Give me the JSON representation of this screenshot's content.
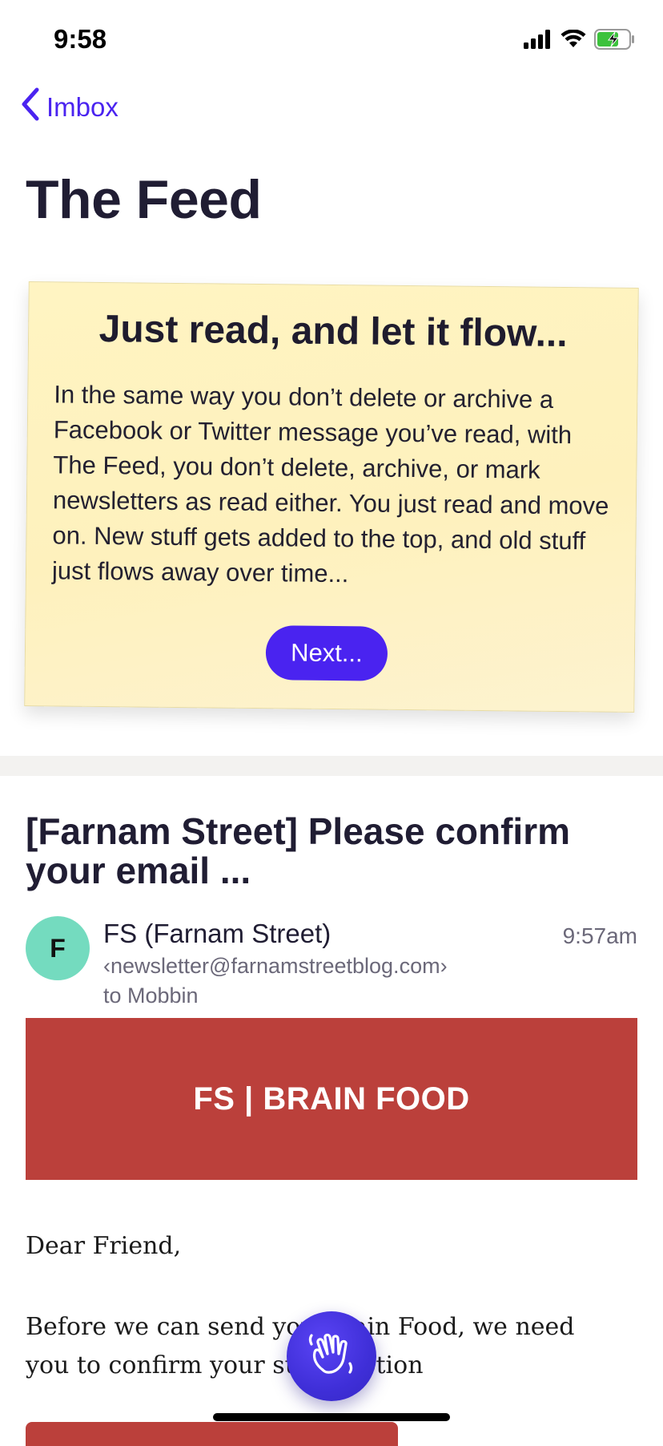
{
  "status_bar": {
    "time": "9:58",
    "icons": [
      "signal-icon",
      "wifi-icon",
      "battery-charging-icon"
    ],
    "battery_color": "#3cc23c"
  },
  "nav": {
    "back_label": "Imbox",
    "back_icon": "chevron-left-icon",
    "accent_color": "#4a23f0"
  },
  "page": {
    "title": "The Feed"
  },
  "tip_card": {
    "heading": "Just read, and let it flow...",
    "body": "In the same way you don’t delete or archive a Facebook or Twitter message you’ve read, with The Feed, you don’t delete, archive, or mark newsletters as read either. You just read and move on. New stuff gets added to the top, and old stuff just flows away over time...",
    "button_label": "Next...",
    "background_color": "#fef1bd"
  },
  "email": {
    "subject": "[Farnam Street] Please confirm your email ...",
    "sender": {
      "avatar_letter": "F",
      "avatar_color": "#74dbbf",
      "name": "FS (Farnam Street)",
      "address": "‹newsletter@farnamstreetblog.com›",
      "to": "to Mobbin",
      "time": "9:57am"
    },
    "banner": {
      "text": "FS | BRAIN FOOD",
      "background_color": "#bb403b"
    },
    "greeting": "Dear Friend,",
    "paragraph": "Before we can send you Brain Food, we need you to confirm your subscription"
  },
  "fab": {
    "icon": "waving-hand-icon",
    "color": "#4a23f0"
  }
}
